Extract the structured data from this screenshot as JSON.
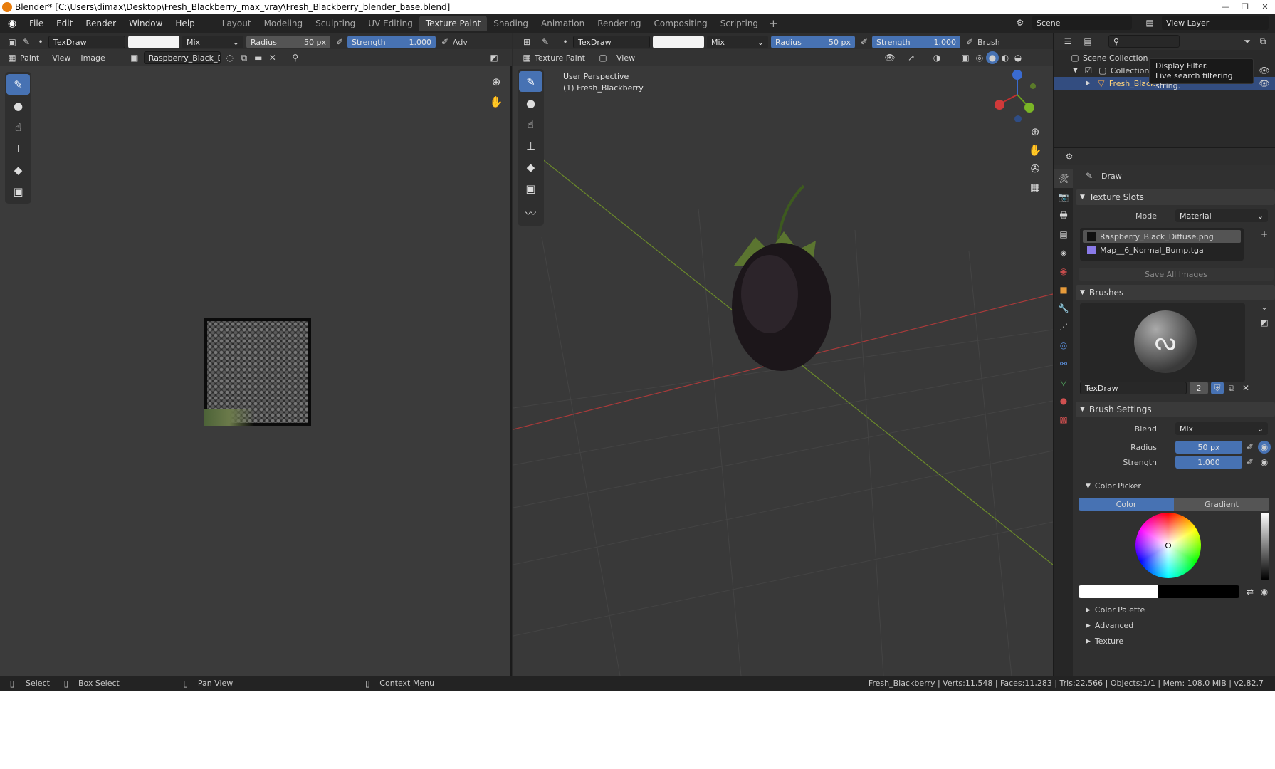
{
  "title": "Blender* [C:\\Users\\dimax\\Desktop\\Fresh_Blackberry_max_vray\\Fresh_Blackberry_blender_base.blend]",
  "menus": [
    "File",
    "Edit",
    "Render",
    "Window",
    "Help"
  ],
  "workspaces": [
    "Layout",
    "Modeling",
    "Sculpting",
    "UV Editing",
    "Texture Paint",
    "Shading",
    "Animation",
    "Rendering",
    "Compositing",
    "Scripting"
  ],
  "active_workspace": "Texture Paint",
  "scene": "Scene",
  "view_layer": "View Layer",
  "left_header": {
    "brush": "TexDraw",
    "blend": "Mix",
    "radius_label": "Radius",
    "radius": "50 px",
    "strength_label": "Strength",
    "strength": "1.000",
    "adv": "Adv"
  },
  "left_sub": {
    "mode": "Paint",
    "view": "View",
    "image": "Image",
    "image_name": "Raspberry_Black_Di..."
  },
  "right_header": {
    "brush": "TexDraw",
    "blend": "Mix",
    "radius_label": "Radius",
    "radius": "50 px",
    "strength_label": "Strength",
    "strength": "1.000",
    "brush_menu": "Brush"
  },
  "right_sub": {
    "mode": "Texture Paint",
    "view": "View"
  },
  "viewport": {
    "line1": "User Perspective",
    "line2": "(1) Fresh_Blackberry"
  },
  "outliner": {
    "scene_collection": "Scene Collection",
    "collection": "Collection",
    "object": "Fresh_Black"
  },
  "tooltip": {
    "line1": "Display Filter.",
    "line2": "Live search filtering string."
  },
  "props": {
    "tool_name": "Draw",
    "texture_slots": "Texture Slots",
    "mode_label": "Mode",
    "mode_value": "Material",
    "slots": [
      "Raspberry_Black_Diffuse.png",
      "Map__6_Normal_Bump.tga"
    ],
    "save_all": "Save All Images",
    "brushes": "Brushes",
    "brush_name": "TexDraw",
    "brush_users": "2",
    "brush_settings": "Brush Settings",
    "blend_label": "Blend",
    "blend_value": "Mix",
    "radius_label": "Radius",
    "radius_value": "50 px",
    "strength_label": "Strength",
    "strength_value": "1.000",
    "color_picker": "Color Picker",
    "color_tab": "Color",
    "gradient_tab": "Gradient",
    "color_palette": "Color Palette",
    "advanced": "Advanced",
    "texture": "Texture"
  },
  "status": {
    "select": "Select",
    "box_select": "Box Select",
    "pan_view": "Pan View",
    "context_menu": "Context Menu",
    "stats": "Fresh_Blackberry | Verts:11,548 | Faces:11,283 | Tris:22,566 | Objects:1/1 | Mem: 108.0 MiB | v2.82.7"
  },
  "colors": {
    "accent": "#4772b3",
    "bg": "#2b2b2b",
    "selected_row": "#334d80"
  }
}
